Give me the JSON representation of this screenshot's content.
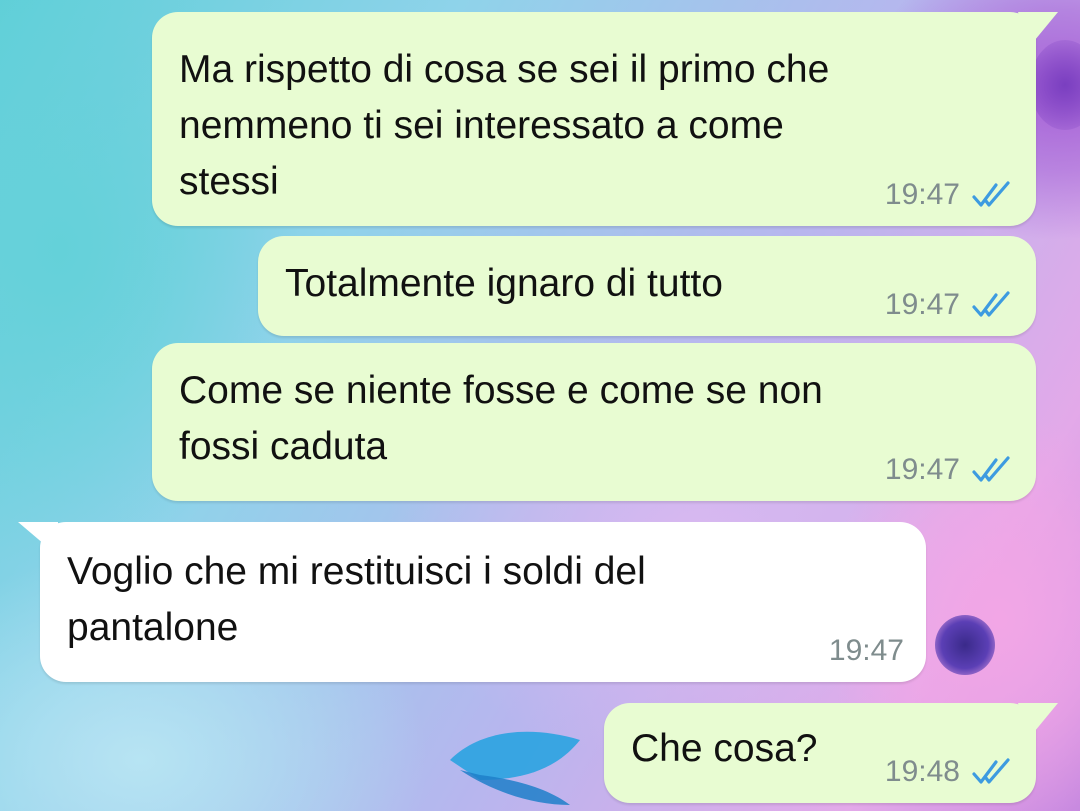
{
  "colors": {
    "outgoing_bubble": "#e8fcd2",
    "incoming_bubble": "#ffffff",
    "timestamp": "#7f8c8d",
    "read_ticks": "#3d9be0"
  },
  "messages": [
    {
      "direction": "outgoing",
      "text": "Ma rispetto di cosa se sei il primo che\nnemmeno ti sei interessato a come\nstessi",
      "time": "19:47",
      "status": "read",
      "status_icon": "double-check-icon"
    },
    {
      "direction": "outgoing",
      "text": "Totalmente ignaro di tutto",
      "time": "19:47",
      "status": "read",
      "status_icon": "double-check-icon"
    },
    {
      "direction": "outgoing",
      "text": "Come se niente fosse e come se non\nfossi caduta",
      "time": "19:47",
      "status": "read",
      "status_icon": "double-check-icon"
    },
    {
      "direction": "incoming",
      "text": "Voglio che mi restituisci i soldi del\npantalone",
      "time": "19:47"
    },
    {
      "direction": "outgoing",
      "text": "Che cosa?",
      "time": "19:48",
      "status": "read",
      "status_icon": "double-check-icon"
    }
  ]
}
